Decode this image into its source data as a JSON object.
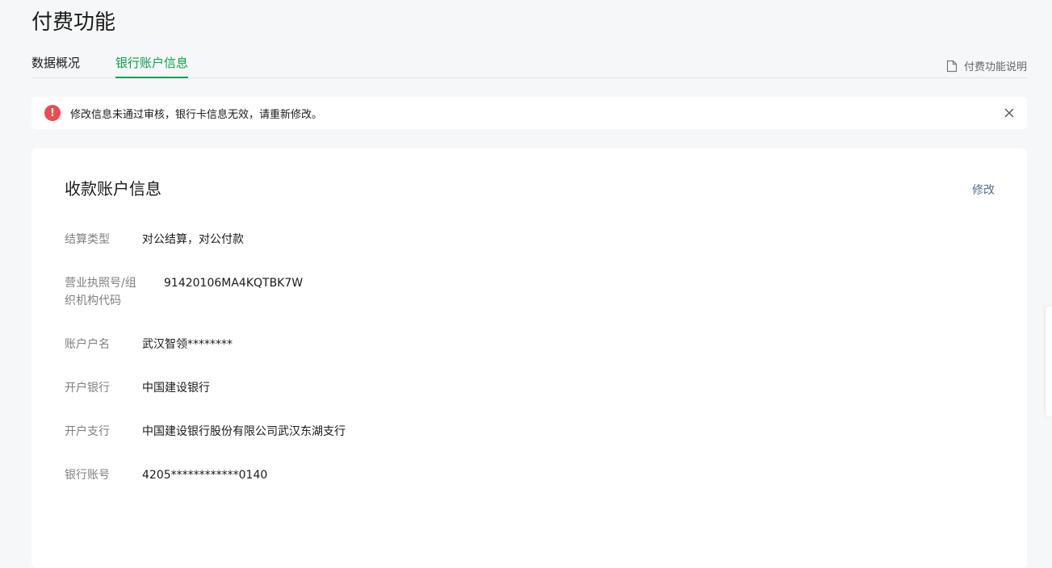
{
  "page": {
    "title": "付费功能"
  },
  "tabs": [
    {
      "label": "数据概况"
    },
    {
      "label": "银行账户信息"
    }
  ],
  "help_link": {
    "label": "付费功能说明"
  },
  "alert": {
    "message": "修改信息未通过审核，银行卡信息无效，请重新修改。",
    "icon_text": "!"
  },
  "card": {
    "title": "收款账户信息",
    "edit_label": "修改",
    "fields": [
      {
        "label": "结算类型",
        "value": "对公结算，对公付款"
      },
      {
        "label": "营业执照号/组织机构代码",
        "value": "91420106MA4KQTBK7W"
      },
      {
        "label": "账户户名",
        "value": "武汉智领********"
      },
      {
        "label": "开户银行",
        "value": "中国建设银行"
      },
      {
        "label": "开户支行",
        "value": "中国建设银行股份有限公司武汉东湖支行"
      },
      {
        "label": "银行账号",
        "value": "4205************0140"
      }
    ]
  },
  "colors": {
    "accent": "#07a24a",
    "error": "#ee4a4f",
    "link": "#576b95",
    "background": "#f6f7f8"
  }
}
